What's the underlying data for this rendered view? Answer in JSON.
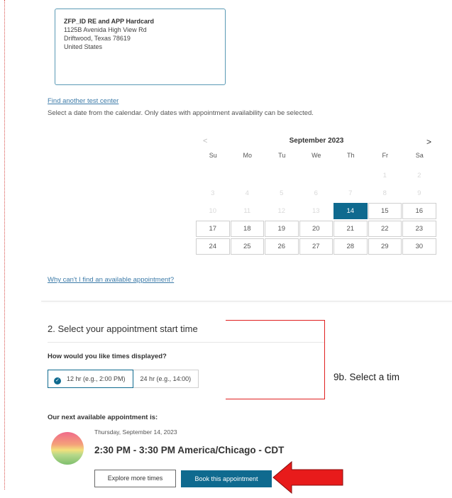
{
  "address": {
    "name": "ZFP_ID RE and APP Hardcard",
    "street": "1125B Avenida High View Rd",
    "city": "Driftwood, Texas 78619",
    "country": "United States"
  },
  "links": {
    "find_another": "Find another test center",
    "why_cant": "Why can't I find an available appointment?"
  },
  "instruction": "Select a date from the calendar. Only dates with appointment availability can be selected.",
  "calendar": {
    "prev": "<",
    "next": ">",
    "month_label": "September 2023",
    "weekdays": [
      "Su",
      "Mo",
      "Tu",
      "We",
      "Th",
      "Fr",
      "Sa"
    ],
    "weeks": [
      [
        {
          "d": "",
          "s": "empty"
        },
        {
          "d": "",
          "s": "empty"
        },
        {
          "d": "",
          "s": "empty"
        },
        {
          "d": "",
          "s": "empty"
        },
        {
          "d": "",
          "s": "empty"
        },
        {
          "d": "1",
          "s": "disabled"
        },
        {
          "d": "2",
          "s": "disabled"
        }
      ],
      [
        {
          "d": "3",
          "s": "disabled"
        },
        {
          "d": "4",
          "s": "disabled"
        },
        {
          "d": "5",
          "s": "disabled"
        },
        {
          "d": "6",
          "s": "disabled"
        },
        {
          "d": "7",
          "s": "disabled"
        },
        {
          "d": "8",
          "s": "disabled"
        },
        {
          "d": "9",
          "s": "disabled"
        }
      ],
      [
        {
          "d": "10",
          "s": "disabled"
        },
        {
          "d": "11",
          "s": "disabled"
        },
        {
          "d": "12",
          "s": "disabled"
        },
        {
          "d": "13",
          "s": "disabled"
        },
        {
          "d": "14",
          "s": "selected"
        },
        {
          "d": "15",
          "s": "avail"
        },
        {
          "d": "16",
          "s": "avail"
        }
      ],
      [
        {
          "d": "17",
          "s": "avail"
        },
        {
          "d": "18",
          "s": "avail"
        },
        {
          "d": "19",
          "s": "avail"
        },
        {
          "d": "20",
          "s": "avail"
        },
        {
          "d": "21",
          "s": "avail"
        },
        {
          "d": "22",
          "s": "avail"
        },
        {
          "d": "23",
          "s": "avail"
        }
      ],
      [
        {
          "d": "24",
          "s": "avail"
        },
        {
          "d": "25",
          "s": "avail"
        },
        {
          "d": "26",
          "s": "avail"
        },
        {
          "d": "27",
          "s": "avail"
        },
        {
          "d": "28",
          "s": "avail"
        },
        {
          "d": "29",
          "s": "avail"
        },
        {
          "d": "30",
          "s": "avail"
        }
      ]
    ]
  },
  "step2": {
    "title": "2. Select your appointment start time",
    "question": "How would you like times displayed?",
    "option_12": "12 hr (e.g., 2:00 PM)",
    "option_24": "24 hr (e.g., 14:00)",
    "selected": "12hr"
  },
  "annotation": {
    "text": "9b. Select a tim",
    "color": "#e02020"
  },
  "next_appointment": {
    "label": "Our next available appointment is:",
    "date": "Thursday, September 14, 2023",
    "time": "2:30 PM - 3:30 PM America/Chicago - CDT",
    "explore_label": "Explore more times",
    "book_label": "Book this appointment"
  },
  "colors": {
    "primary": "#0f6a8f",
    "link": "#3b7aa8",
    "annotation_red": "#e02020"
  }
}
